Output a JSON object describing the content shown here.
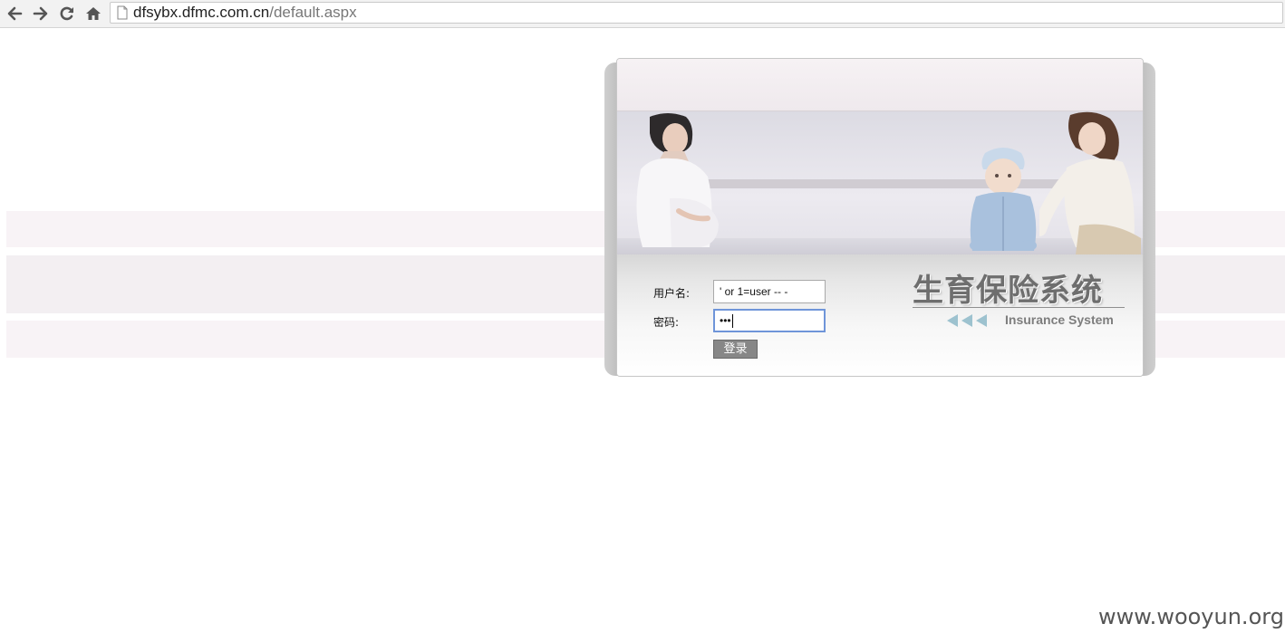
{
  "browser": {
    "url_host": "dfsybx.dfmc.com.cn",
    "url_path": "/default.aspx"
  },
  "login": {
    "username_label": "用户名:",
    "username_value": "' or 1=user -- -",
    "password_label": "密码:",
    "password_mask": "•••",
    "submit_label": "登录"
  },
  "branding": {
    "title": "生育保险系统",
    "subtitle": "Insurance System"
  },
  "watermark": "www.wooyun.org",
  "colors": {
    "toolbar_bg": "#f2f2f2",
    "focus_border": "#6f95d9",
    "button_bg": "#878787",
    "title_gray": "#6e6e6e",
    "arrow_blue": "#9dc2cf"
  }
}
